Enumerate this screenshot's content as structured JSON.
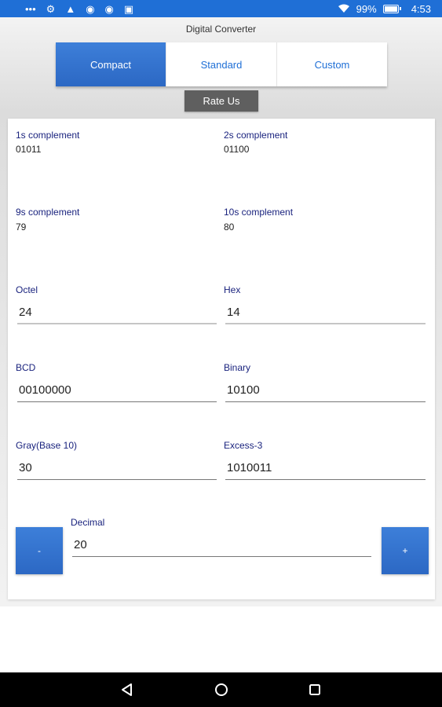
{
  "status": {
    "battery": "99%",
    "time": "4:53"
  },
  "app": {
    "title": "Digital Converter",
    "tabs": [
      {
        "label": "Compact"
      },
      {
        "label": "Standard"
      },
      {
        "label": "Custom"
      }
    ],
    "rate_label": "Rate Us"
  },
  "results": {
    "ones": {
      "label": "1s complement",
      "value": "01011"
    },
    "twos": {
      "label": "2s complement",
      "value": "01100"
    },
    "nines": {
      "label": "9s complement",
      "value": "79"
    },
    "tens": {
      "label": "10s complement",
      "value": "80"
    }
  },
  "fields": {
    "octal": {
      "label": "Octel",
      "value": "24"
    },
    "hex": {
      "label": "Hex",
      "value": "14"
    },
    "bcd": {
      "label": "BCD",
      "value": "00100000"
    },
    "binary": {
      "label": "Binary",
      "value": "10100"
    },
    "gray": {
      "label": "Gray(Base 10)",
      "value": "30"
    },
    "excess3": {
      "label": "Excess-3",
      "value": "1010011"
    },
    "decimal": {
      "label": "Decimal",
      "value": "20"
    }
  },
  "stepper": {
    "minus": "-",
    "plus": "+"
  },
  "colors": {
    "accent": "#1f6fd6",
    "label": "#1a237e"
  }
}
